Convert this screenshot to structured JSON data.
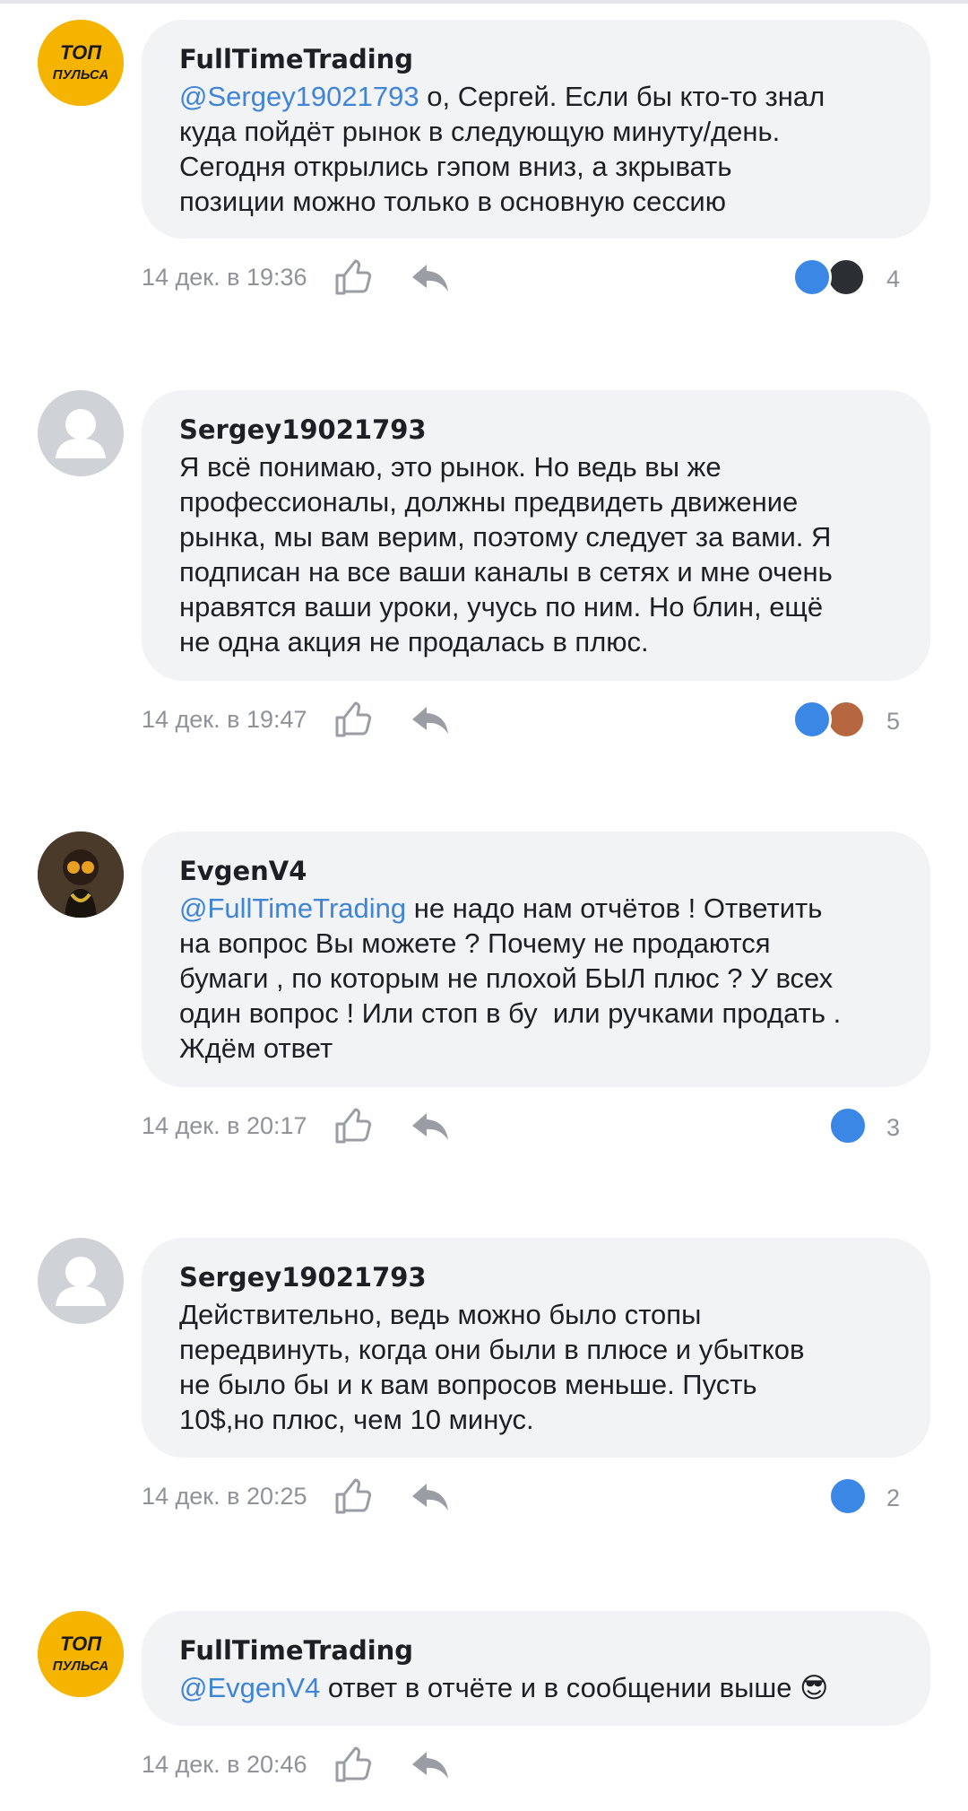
{
  "comments": [
    {
      "author": "FullTimeTrading",
      "avatar_badge": "ТОП ПУЛЬСА",
      "mention": "@Sergey19021793",
      "text": " о, Сергей. Если бы кто-то знал\nкуда пойдёт рынок в следующую минуту/день.\nСегодня открылись гэпом вниз, а зкрывать\nпозиции можно только в основную сессию",
      "time": "14 дек. в 19:36",
      "reaction_count": "4"
    },
    {
      "author": "Sergey19021793",
      "text": "Я всё понимаю, это рынок. Но ведь вы же\nпрофессионалы, должны предвидеть движение\nрынка, мы вам верим, поэтому следует за вами. Я\nподписан на все ваши каналы в сетях и мне очень\nнравятся ваши уроки, учусь по ним. Но блин, ещё\nне одна акция не продалась в плюс.",
      "time": "14 дек. в 19:47",
      "reaction_count": "5"
    },
    {
      "author": "EvgenV4",
      "mention": "@FullTimeTrading",
      "text": " не надо нам отчётов ! Ответить\nна вопрос Вы можете ? Почему не продаются\nбумаги , по которым не плохой БЫЛ плюс ? У всех\nодин вопрос ! Или стоп в бу  или ручками продать .\nЖдём ответ",
      "time": "14 дек. в 20:17",
      "reaction_count": "3"
    },
    {
      "author": "Sergey19021793",
      "text": "Действительно, ведь можно было стопы\nпередвинуть, когда они были в плюсе и убытков\nне было бы и к вам вопросов меньше. Пусть\n10$,но плюс, чем 10 минус.",
      "time": "14 дек. в 20:25",
      "reaction_count": "2"
    },
    {
      "author": "FullTimeTrading",
      "avatar_badge": "ТОП ПУЛЬСА",
      "mention": "@EvgenV4",
      "text": " ответ в отчёте и в сообщении выше 😎",
      "time": "14 дек. в 20:46",
      "reaction_count": ""
    }
  ],
  "colors": {
    "mention": "#3f84d6",
    "bubble": "#f2f3f5",
    "meta_text": "#8f9298",
    "reaction_like": "#3b87e6"
  },
  "icons": {
    "like": "thumb-up-icon",
    "reply": "reply-arrow-icon",
    "reactions": [
      "like-reaction-icon",
      "rocket-reaction-icon",
      "sofa-reaction-icon"
    ]
  }
}
